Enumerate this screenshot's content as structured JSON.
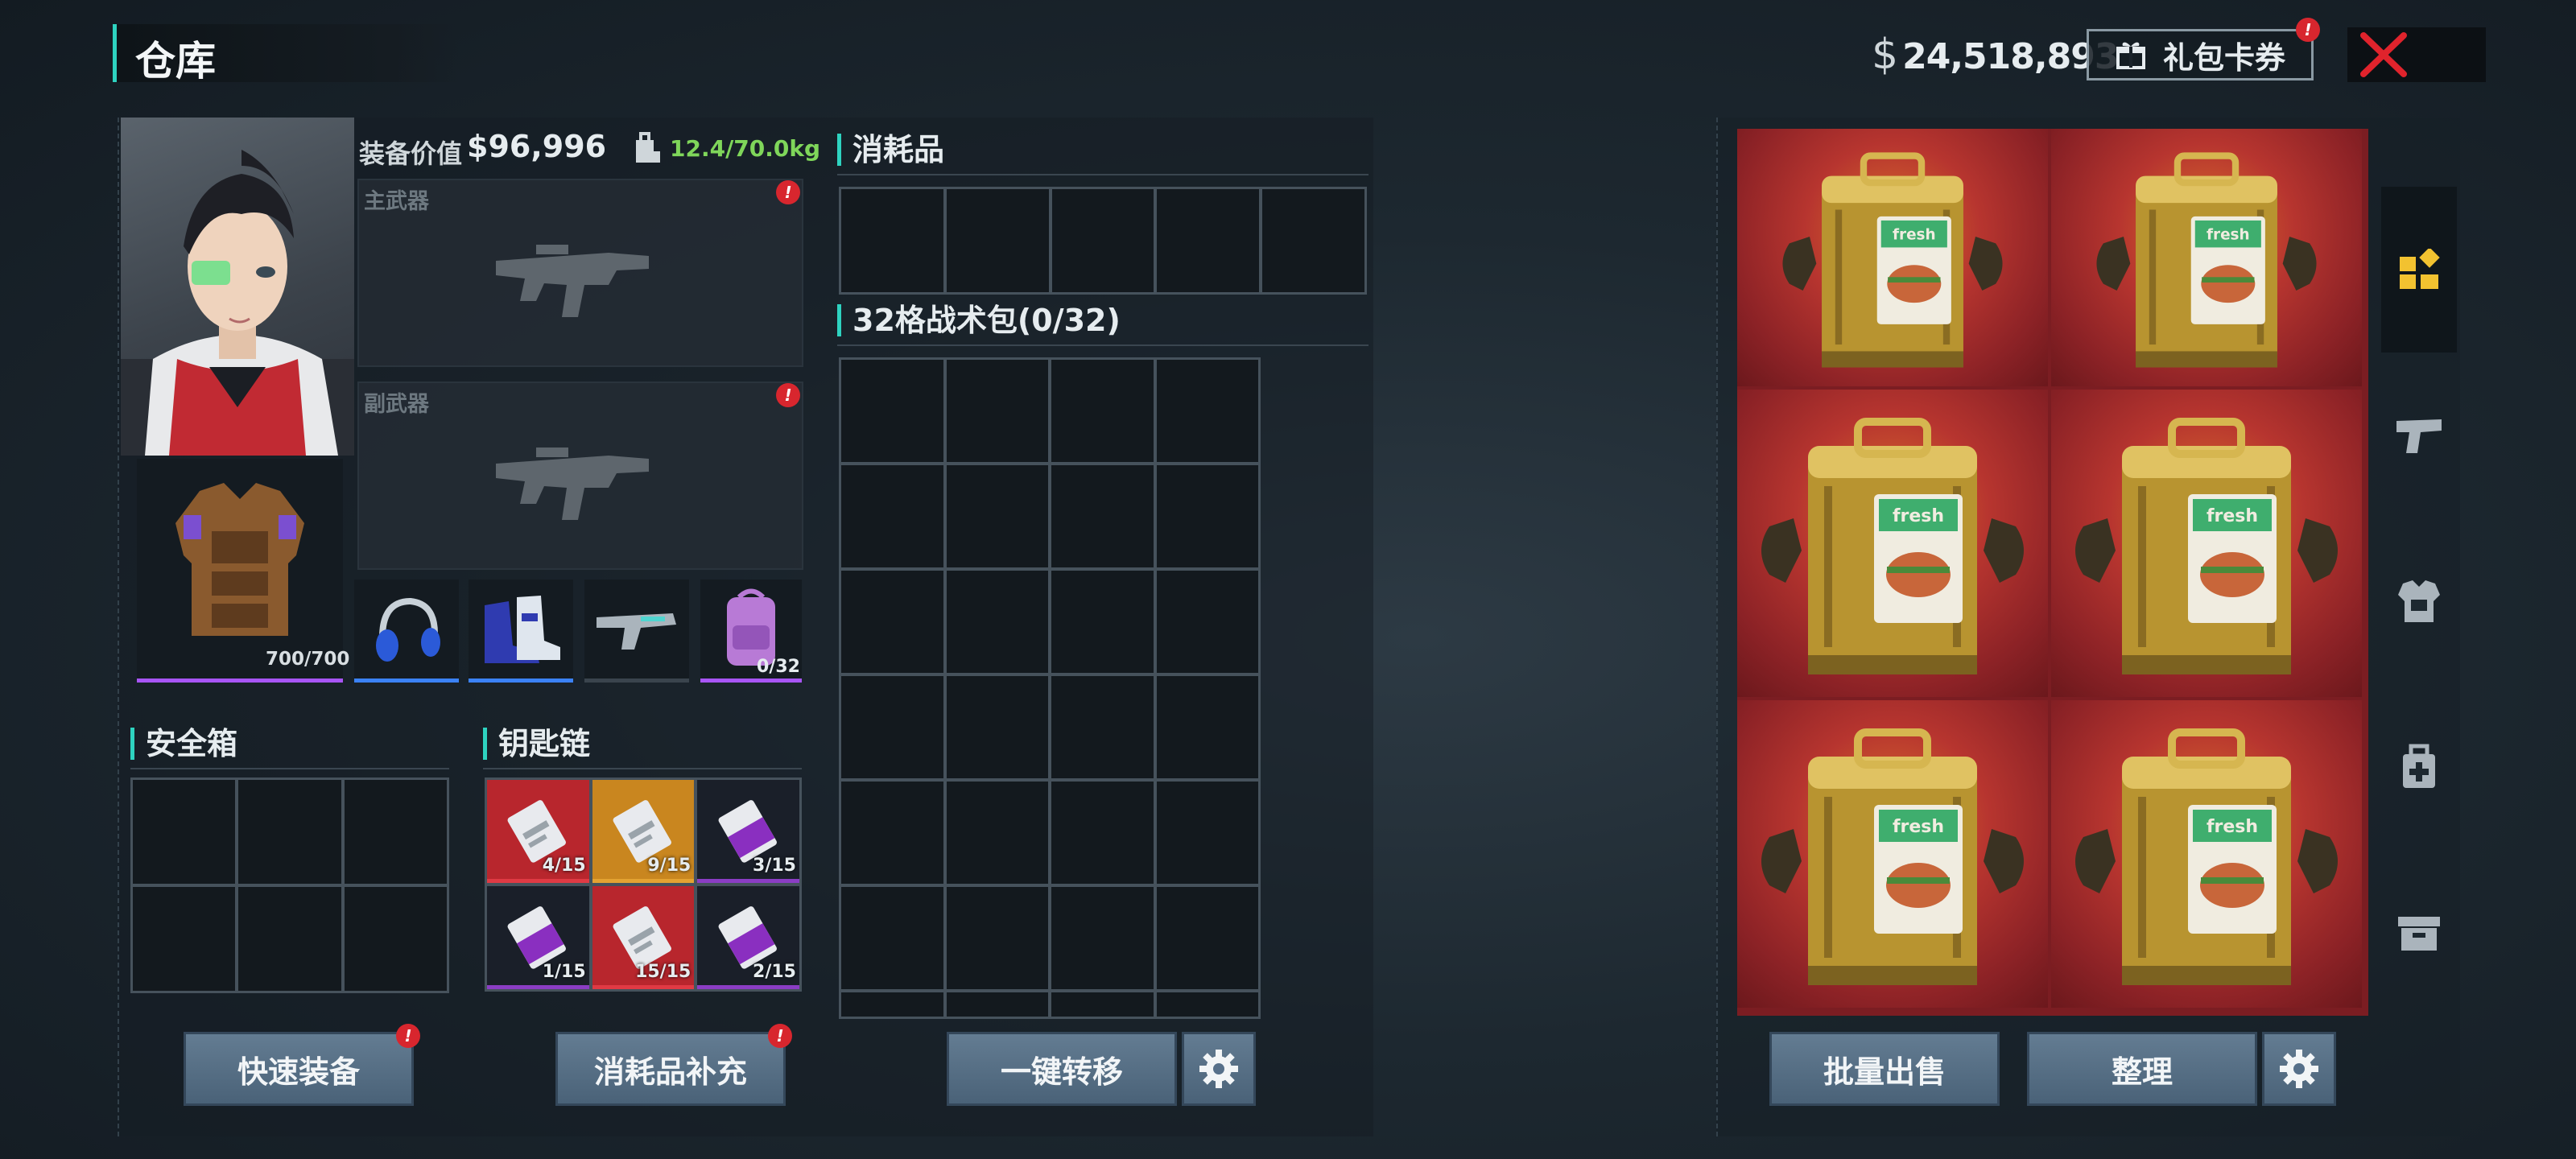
{
  "header": {
    "title": "仓库",
    "currency_symbol": "$",
    "money": "24,518,893",
    "gift_label": "礼包卡券",
    "badge": "!"
  },
  "loadout": {
    "equip_value_label": "装备价值",
    "equip_value": "$96,996",
    "weight": "12.4/70.0kg",
    "primary_label": "主武器",
    "secondary_label": "副武器",
    "armor_durability": "700/700",
    "backpack_capacity": "0/32"
  },
  "consumables": {
    "title": "消耗品"
  },
  "tactical_bag": {
    "title": "32格战术包(0/32)"
  },
  "safe_box": {
    "title": "安全箱"
  },
  "keychain": {
    "title": "钥匙链",
    "keys": [
      {
        "count": "4/15",
        "color": "#b8262d"
      },
      {
        "count": "9/15",
        "color": "#c9861f"
      },
      {
        "count": "3/15",
        "color": "#7a2aa8"
      },
      {
        "count": "1/15",
        "color": "#7a2aa8"
      },
      {
        "count": "15/15",
        "color": "#b8262d"
      },
      {
        "count": "2/15",
        "color": "#7a2aa8"
      }
    ]
  },
  "buttons": {
    "quick_equip": "快速装备",
    "refill": "消耗品补充",
    "transfer_all": "一键转移",
    "bulk_sell": "批量出售",
    "sort": "整理"
  },
  "storage": {
    "item_name": "fresh",
    "items": 6
  },
  "sidebar": {
    "tabs": [
      "grid-icon",
      "pistol-icon",
      "armor-icon",
      "medkit-icon",
      "crate-icon"
    ]
  },
  "colors": {
    "accent": "#2ed3c0",
    "weight": "#7fd65a",
    "badge": "#d8262e",
    "rare_epic": "#a855f7"
  }
}
